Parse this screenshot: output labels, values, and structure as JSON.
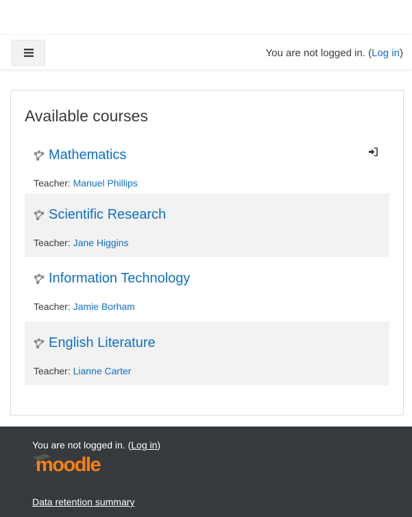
{
  "header": {
    "drawer_icon": "hamburger-icon",
    "login_prefix": "You are not logged in. (",
    "login_link": "Log in",
    "login_suffix": ")"
  },
  "main": {
    "title": "Available courses",
    "course_icon": "course-icon",
    "enrol_icon": "sign-in-icon",
    "courses": [
      {
        "name": "Mathematics",
        "teacher_label": "Teacher:",
        "teacher": "Manuel Phillips"
      },
      {
        "name": "Scientific Research",
        "teacher_label": "Teacher:",
        "teacher": "Jane Higgins"
      },
      {
        "name": "Information Technology",
        "teacher_label": "Teacher:",
        "teacher": "Jamie Borham"
      },
      {
        "name": "English Literature",
        "teacher_label": "Teacher:",
        "teacher": "Lianne Carter"
      }
    ]
  },
  "footer": {
    "login_prefix": "You are not logged in. (",
    "login_link": "Log in",
    "login_suffix": ")",
    "logo_text": "moodle",
    "data_retention": "Data retention summary"
  },
  "colors": {
    "link": "#0f6fc5",
    "footer_bg": "#373a3c",
    "logo_orange": "#f98012",
    "stripe": "#f2f2f2"
  }
}
